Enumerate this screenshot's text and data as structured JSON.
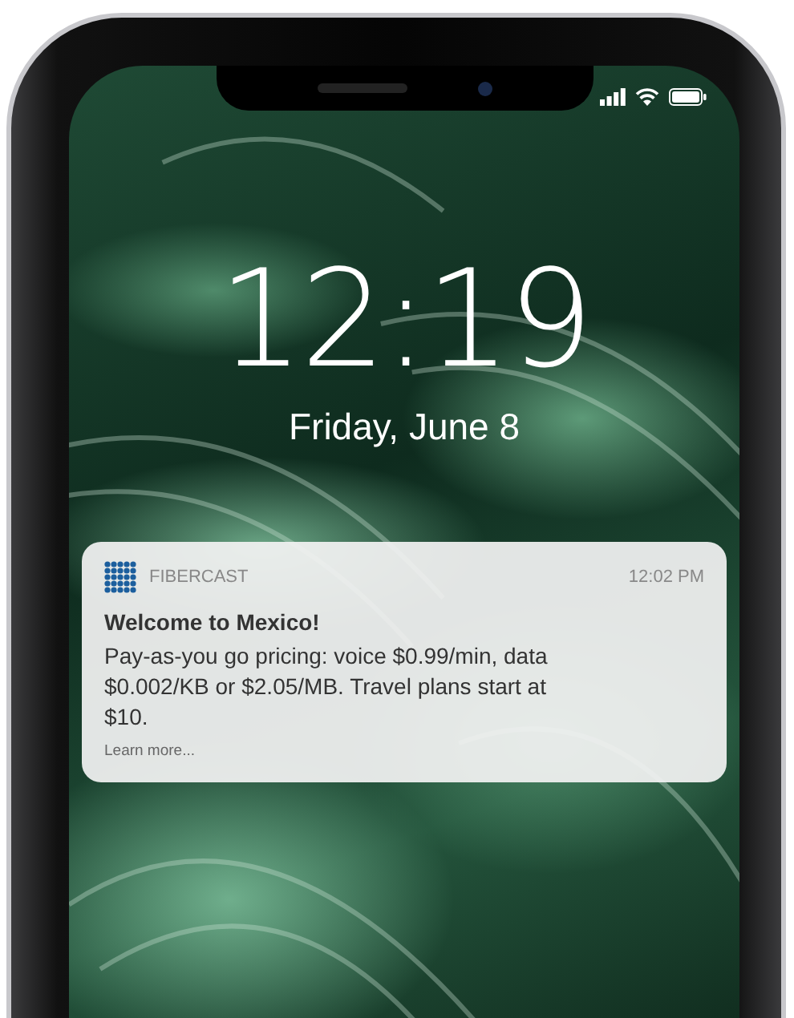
{
  "lock_screen": {
    "time": "12:19",
    "date": "Friday, June 8"
  },
  "notification": {
    "app": "FIBERCAST",
    "time": "12:02 PM",
    "title": "Welcome to Mexico!",
    "body": "Pay-as-you go pricing: voice $0.99/min, data $0.002/KB or $2.05/MB. Travel plans start at $10.",
    "link": "Learn more..."
  }
}
